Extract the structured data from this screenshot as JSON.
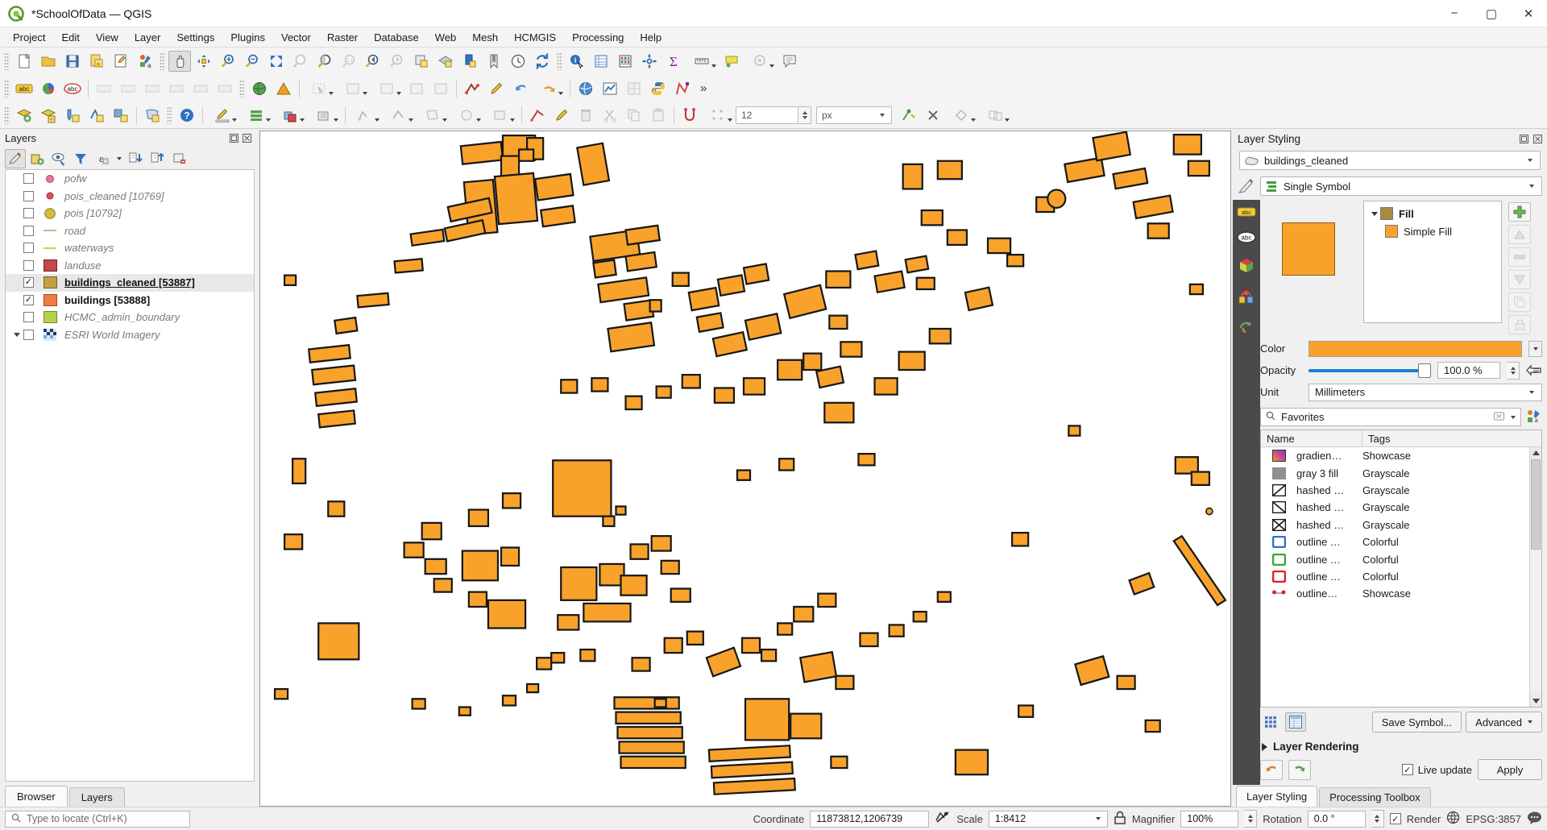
{
  "window": {
    "title": "*SchoolOfData — QGIS",
    "app_icon": "qgis-logo-icon",
    "minimize": "−",
    "maximize": "▢",
    "close": "✕"
  },
  "menubar": {
    "items": [
      {
        "label": "Project"
      },
      {
        "label": "Edit"
      },
      {
        "label": "View"
      },
      {
        "label": "Layer"
      },
      {
        "label": "Settings"
      },
      {
        "label": "Plugins"
      },
      {
        "label": "Vector"
      },
      {
        "label": "Raster"
      },
      {
        "label": "Database"
      },
      {
        "label": "Web"
      },
      {
        "label": "Mesh"
      },
      {
        "label": "HCMGIS"
      },
      {
        "label": "Processing"
      },
      {
        "label": "Help"
      }
    ]
  },
  "toolbar_row1": {
    "overflow_label": "»",
    "buttons": [
      {
        "name": "new-project-icon"
      },
      {
        "name": "open-project-icon"
      },
      {
        "name": "save-project-icon"
      },
      {
        "name": "save-project-as-icon"
      },
      {
        "name": "new-print-layout-icon"
      },
      {
        "name": "style-manager-icon"
      },
      {
        "name": "pan-map-icon"
      },
      {
        "name": "pan-to-selection-icon"
      },
      {
        "name": "zoom-in-icon"
      },
      {
        "name": "zoom-out-icon"
      },
      {
        "name": "zoom-full-icon"
      },
      {
        "name": "zoom-to-selection-icon"
      },
      {
        "name": "zoom-to-layer-icon"
      },
      {
        "name": "zoom-native-icon"
      },
      {
        "name": "zoom-last-icon"
      },
      {
        "name": "zoom-next-icon"
      },
      {
        "name": "refresh-icon"
      },
      {
        "name": "new-map-view-icon"
      },
      {
        "name": "new-3d-map-view-icon"
      },
      {
        "name": "clock-icon"
      },
      {
        "name": "refresh-map-icon"
      },
      {
        "name": "identify-features-icon"
      },
      {
        "name": "open-attribute-table-icon"
      },
      {
        "name": "statistics-icon"
      },
      {
        "name": "processing-icon"
      },
      {
        "name": "sum-icon"
      },
      {
        "name": "measure-line-icon"
      },
      {
        "name": "map-tips-icon"
      },
      {
        "name": "annotations-icon"
      },
      {
        "name": "text-annotation-icon"
      }
    ]
  },
  "toolbar_row2": {
    "overflow_label": "»",
    "buttons": [
      {
        "name": "label-abc-icon"
      },
      {
        "name": "layer-diagram-icon"
      },
      {
        "name": "label-red-abc-icon"
      },
      {
        "name": "highlight-pinned-labels-icon"
      },
      {
        "name": "pin-labels-icon"
      },
      {
        "name": "show-hide-labels-icon"
      },
      {
        "name": "move-label-icon"
      },
      {
        "name": "rotate-label-icon"
      },
      {
        "name": "change-label-icon"
      },
      {
        "name": "globe-green-icon"
      },
      {
        "name": "triangle-warning-icon"
      },
      {
        "name": "select-features-icon"
      },
      {
        "name": "select-by-polygon-icon"
      },
      {
        "name": "select-by-freehand-icon"
      },
      {
        "name": "select-by-radius-icon"
      },
      {
        "name": "deselect-features-icon"
      },
      {
        "name": "select-by-expression-icon"
      },
      {
        "name": "digitize-icon"
      },
      {
        "name": "edit-pencil-icon"
      },
      {
        "name": "undo-icon"
      },
      {
        "name": "redo-icon"
      },
      {
        "name": "world-globe-icon"
      },
      {
        "name": "plot-chart-icon"
      },
      {
        "name": "georeferencer-icon"
      },
      {
        "name": "python-console-icon"
      },
      {
        "name": "plugin-icon"
      }
    ]
  },
  "toolbar_row3": {
    "vertex_size_value": "12",
    "vertex_size_unit": "px",
    "buttons": [
      {
        "name": "add-layer-icon"
      },
      {
        "name": "add-vector-layer-icon"
      },
      {
        "name": "add-point-layer-icon"
      },
      {
        "name": "add-line-layer-icon"
      },
      {
        "name": "add-polygon-layer-icon"
      },
      {
        "name": "add-mesh-layer-icon"
      },
      {
        "name": "help-icon"
      },
      {
        "name": "current-edits-icon"
      },
      {
        "name": "toggle-editing-icon"
      },
      {
        "name": "save-layer-edits-icon"
      },
      {
        "name": "multi-edit-icon"
      },
      {
        "name": "add-feature-point-icon"
      },
      {
        "name": "add-feature-line-icon"
      },
      {
        "name": "add-feature-polygon-icon"
      },
      {
        "name": "add-circle-icon"
      },
      {
        "name": "add-ring-icon"
      },
      {
        "name": "vertex-tool-icon"
      },
      {
        "name": "modify-attributes-icon"
      },
      {
        "name": "delete-selected-icon"
      },
      {
        "name": "cut-features-icon"
      },
      {
        "name": "copy-features-icon"
      },
      {
        "name": "paste-features-icon"
      },
      {
        "name": "snapping-toggle-icon"
      },
      {
        "name": "snapping-mode-icon"
      },
      {
        "name": "enable-tracing-icon"
      },
      {
        "name": "close-x-icon"
      },
      {
        "name": "topological-editing-icon"
      },
      {
        "name": "avoid-overlap-icon"
      }
    ]
  },
  "layers_panel": {
    "title": "Layers",
    "dock_float_icon": "dock-float-icon",
    "dock_close_icon": "dock-close-icon",
    "toolbar": [
      {
        "name": "open-layer-styling-panel-button",
        "icon": "paintbrush-icon",
        "active": true
      },
      {
        "name": "add-group-button",
        "icon": "add-group-icon"
      },
      {
        "name": "manage-map-themes-button",
        "icon": "eye-icon"
      },
      {
        "name": "filter-legend-button",
        "icon": "funnel-icon"
      },
      {
        "name": "filter-legend-expression-button",
        "icon": "epsilon-icon"
      },
      {
        "name": "expand-all-button",
        "icon": "expand-all-icon"
      },
      {
        "name": "collapse-all-button",
        "icon": "collapse-all-icon"
      },
      {
        "name": "remove-layer-button",
        "icon": "remove-layer-icon"
      }
    ],
    "layers": [
      {
        "name": "pofw",
        "checked": false,
        "symbol": "point",
        "color": "#e8798f",
        "state": "normal"
      },
      {
        "name": "pois_cleaned [10769]",
        "checked": false,
        "symbol": "point",
        "color": "#d94f63",
        "state": "normal"
      },
      {
        "name": "pois [10792]",
        "checked": false,
        "symbol": "bigpoint",
        "color": "#d6bc3f",
        "state": "normal"
      },
      {
        "name": "road",
        "checked": false,
        "symbol": "line",
        "color": "#c8bb94",
        "state": "normal"
      },
      {
        "name": "waterways",
        "checked": false,
        "symbol": "line",
        "color": "#c3d94f",
        "state": "normal"
      },
      {
        "name": "landuse",
        "checked": false,
        "symbol": "fill",
        "color": "#c04a4a",
        "state": "normal"
      },
      {
        "name": "buildings_cleaned [53887]",
        "checked": true,
        "symbol": "fill",
        "color": "#c3a044",
        "state": "active"
      },
      {
        "name": "buildings [53888]",
        "checked": true,
        "symbol": "fill",
        "color": "#ef7b47",
        "state": "bold"
      },
      {
        "name": "HCMC_admin_boundary",
        "checked": false,
        "symbol": "fill",
        "color": "#b5d147",
        "state": "normal"
      },
      {
        "name": "ESRI World Imagery",
        "checked": false,
        "symbol": "raster",
        "color": "#6fa8dc",
        "state": "normal",
        "expandable": true
      }
    ],
    "tabs": [
      {
        "label": "Browser",
        "active": false
      },
      {
        "label": "Layers",
        "active": true
      }
    ]
  },
  "layer_styling": {
    "title": "Layer Styling",
    "dock_float_icon": "dock-float-icon",
    "dock_close_icon": "dock-close-icon",
    "layer_selector": "buildings_cleaned",
    "renderer": "Single Symbol",
    "sidebar_icons": [
      {
        "name": "labels-icon"
      },
      {
        "name": "masks-icon"
      },
      {
        "name": "3d-view-icon"
      },
      {
        "name": "diagrams-icon"
      },
      {
        "name": "history-icon"
      }
    ],
    "symbol_tree": [
      {
        "label": "Fill",
        "level": 0,
        "color": "#a88a46",
        "bold": true,
        "expanded": true
      },
      {
        "label": "Simple Fill",
        "level": 1,
        "color": "#f9a22b",
        "bold": false
      }
    ],
    "symbol_buttons": [
      {
        "name": "add-symbol-layer-button",
        "icon": "plus-green-icon"
      },
      {
        "name": "move-symbol-up-button",
        "icon": "arrow-up-icon"
      },
      {
        "name": "remove-symbol-layer-button",
        "icon": "minus-icon"
      },
      {
        "name": "move-symbol-down-button",
        "icon": "arrow-down-icon"
      },
      {
        "name": "duplicate-symbol-button",
        "icon": "duplicate-icon"
      },
      {
        "name": "lock-symbol-button",
        "icon": "lock-icon"
      }
    ],
    "color": {
      "label": "Color",
      "value": "#f9a22b"
    },
    "opacity": {
      "label": "Opacity",
      "value": "100.0 %",
      "percent": 100
    },
    "unit": {
      "label": "Unit",
      "value": "Millimeters"
    },
    "search": {
      "placeholder": "Favorites",
      "value": "Favorites",
      "clear_icon": "clear-icon"
    },
    "symbol_table": {
      "columns": [
        "Name",
        "Tags"
      ],
      "rows": [
        {
          "name": "gradien…",
          "tags": "Showcase",
          "icon": "gradient-swatch"
        },
        {
          "name": "gray 3 fill",
          "tags": "Grayscale",
          "icon": "gray-swatch"
        },
        {
          "name": "hashed …",
          "tags": "Grayscale",
          "icon": "hatch-fwd-swatch"
        },
        {
          "name": "hashed …",
          "tags": "Grayscale",
          "icon": "hatch-back-swatch"
        },
        {
          "name": "hashed …",
          "tags": "Grayscale",
          "icon": "hatch-cross-swatch"
        },
        {
          "name": "outline …",
          "tags": "Colorful",
          "icon": "outline-blue-swatch"
        },
        {
          "name": "outline …",
          "tags": "Colorful",
          "icon": "outline-green-swatch"
        },
        {
          "name": "outline …",
          "tags": "Colorful",
          "icon": "outline-red-swatch"
        },
        {
          "name": "outline…",
          "tags": "Showcase",
          "icon": "outline-marker-swatch"
        }
      ]
    },
    "view_buttons": [
      {
        "name": "icon-view-button",
        "icon": "grid-icon",
        "active": false
      },
      {
        "name": "list-view-button",
        "icon": "list-icon",
        "active": true
      }
    ],
    "save_symbol_label": "Save Symbol...",
    "advanced_label": "Advanced",
    "layer_rendering_label": "Layer Rendering",
    "undo_icon": "undo-orange-icon",
    "redo_icon": "redo-green-icon",
    "live_update_label": "Live update",
    "live_update_checked": true,
    "apply_label": "Apply",
    "tabs": [
      {
        "label": "Layer Styling",
        "active": true
      },
      {
        "label": "Processing Toolbox",
        "active": false
      }
    ]
  },
  "statusbar": {
    "locator_placeholder": "Type to locate (Ctrl+K)",
    "coordinate_label": "Coordinate",
    "coordinate_value": "11873812,1206739",
    "scale_label": "Scale",
    "scale_value": "1:8412",
    "magnifier_label": "Magnifier",
    "magnifier_value": "100%",
    "rotation_label": "Rotation",
    "rotation_value": "0.0 °",
    "render_label": "Render",
    "render_checked": true,
    "crs_label": "EPSG:3857",
    "messages_icon": "messages-icon",
    "lock-scale-icon": "lock-icon",
    "toggle-extents-icon": "extents-icon"
  },
  "map": {
    "background": "#ffffff",
    "building_fill": "#f9a22b",
    "building_stroke": "#1a1a1a",
    "note": "Orange building polygons on white background"
  }
}
